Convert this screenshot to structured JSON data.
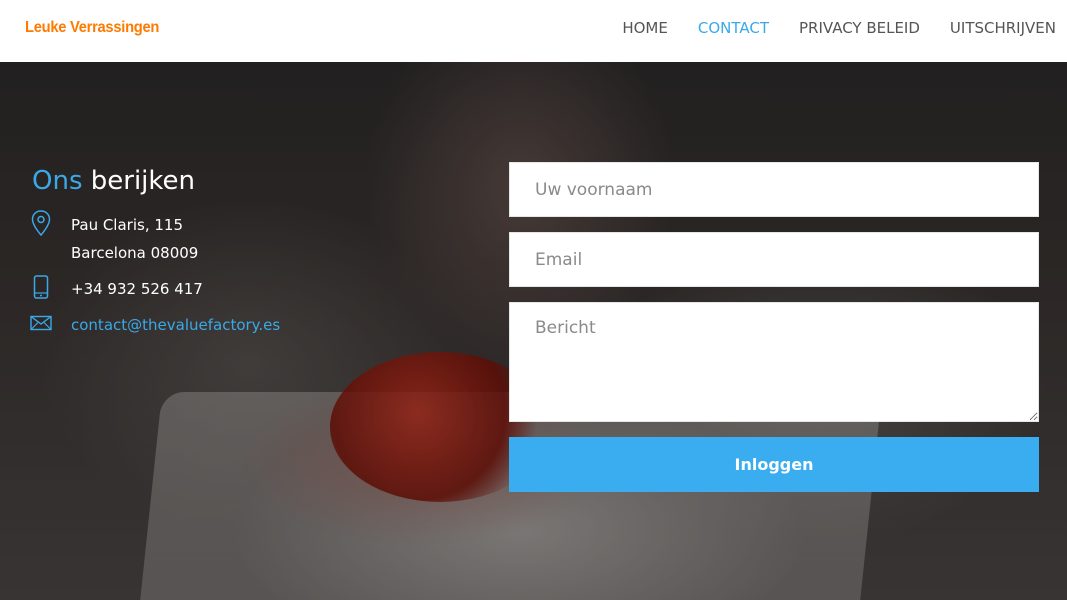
{
  "header": {
    "logo": "Leuke Verrassingen",
    "nav": [
      {
        "label": "HOME",
        "active": false
      },
      {
        "label": "CONTACT",
        "active": true
      },
      {
        "label": "PRIVACY BELEID",
        "active": false
      },
      {
        "label": "UITSCHRIJVEN",
        "active": false
      }
    ]
  },
  "contact": {
    "title_accent": "Ons",
    "title_rest": "berijken",
    "address_line1": "Pau Claris, 115",
    "address_line2": "Barcelona 08009",
    "phone": "+34 932 526 417",
    "email": "contact@thevaluefactory.es",
    "icons": [
      "map-pin-icon",
      "phone-icon",
      "envelope-icon"
    ]
  },
  "form": {
    "firstname_placeholder": "Uw voornaam",
    "email_placeholder": "Email",
    "message_placeholder": "Bericht",
    "submit_label": "Inloggen"
  },
  "colors": {
    "accent": "#3aa9e8",
    "logo": "#ff7a00",
    "button": "#3aacf0",
    "nav_text": "#555555"
  }
}
